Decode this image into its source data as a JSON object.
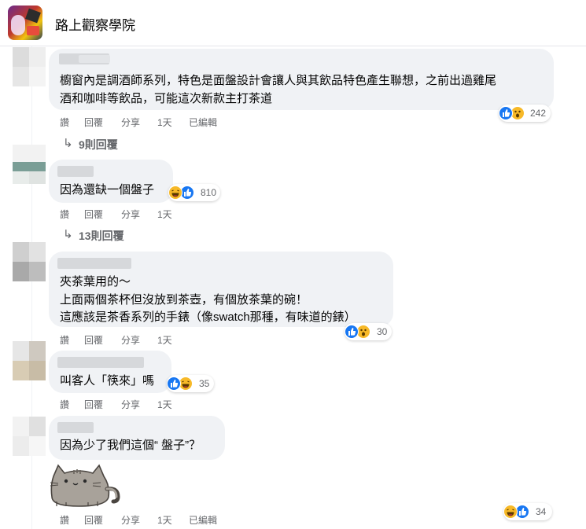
{
  "group": {
    "name": "路上觀察學院"
  },
  "comments": [
    {
      "lines": [
        "櫥窗內是調酒師系列，特色是面盤設計會讓人與其飲品特色產生聯想，之前出過雞尾",
        "酒和咖啡等飲品，可能這次新款主打茶道"
      ],
      "actions": [
        "讚",
        "回覆",
        "分享",
        "1天",
        "已編輯"
      ],
      "reactions": {
        "icons": [
          "like",
          "wow"
        ],
        "count": "242"
      },
      "replies": "9則回覆"
    },
    {
      "lines": [
        "因為還缺一個盤子"
      ],
      "actions": [
        "讚",
        "回覆",
        "分享",
        "1天"
      ],
      "reactions": {
        "icons": [
          "haha",
          "like"
        ],
        "count": "810"
      },
      "replies": "13則回覆"
    },
    {
      "lines": [
        "夾茶葉用的～",
        "上面兩個茶杯但沒放到茶壺，有個放茶葉的碗！",
        "這應該是茶香系列的手錶（像swatch那種，有味道的錶）"
      ],
      "actions": [
        "讚",
        "回覆",
        "分享",
        "1天"
      ],
      "reactions": {
        "icons": [
          "like",
          "wow"
        ],
        "count": "30"
      }
    },
    {
      "lines": [
        "叫客人「筷來」嗎"
      ],
      "actions": [
        "讚",
        "回覆",
        "分享",
        "1天"
      ],
      "reactions": {
        "icons": [
          "like",
          "haha"
        ],
        "count": "35"
      }
    },
    {
      "lines": [
        "因為少了我們這個“ 盤子”？"
      ],
      "actions": [
        "讚",
        "回覆",
        "分享",
        "1天",
        "已編輯"
      ],
      "reactions": {
        "icons": [
          "haha",
          "like"
        ],
        "count": "34"
      },
      "sticker": "pusheen-cat-sticker"
    }
  ],
  "colors": {
    "bubble": "#f0f2f5",
    "meta_text": "#65676b",
    "like_blue": "#1877f2",
    "emoji_yellow": "#f7b928"
  }
}
